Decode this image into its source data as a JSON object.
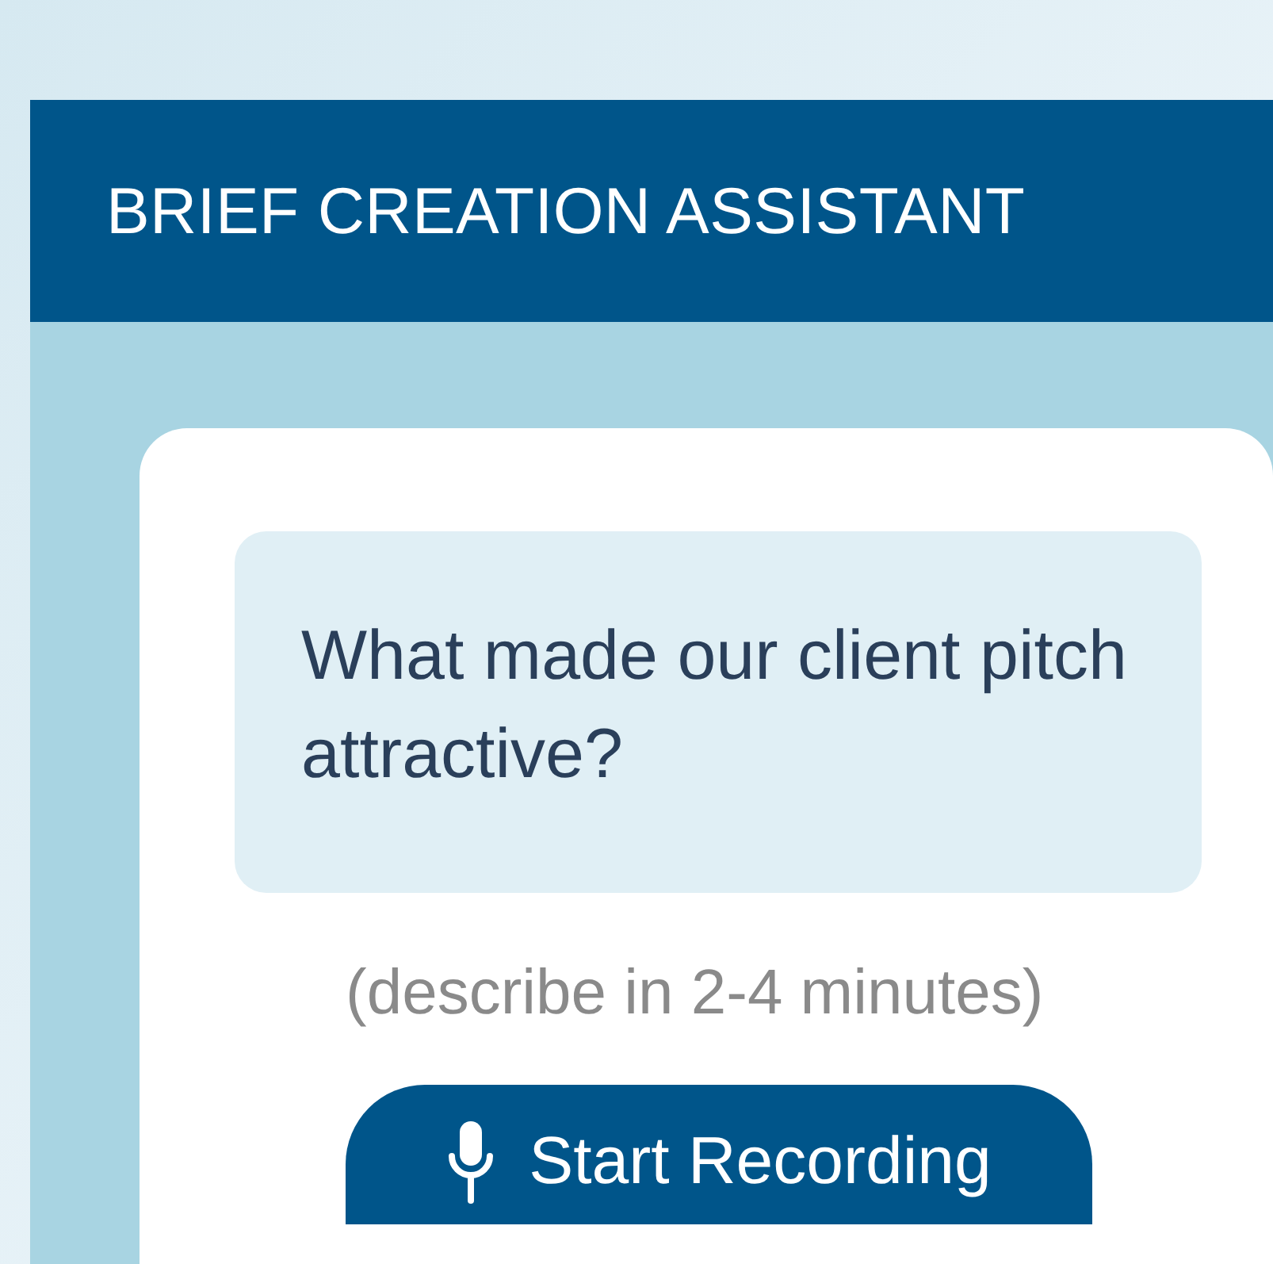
{
  "header": {
    "title": "BRIEF CREATION ASSISTANT"
  },
  "question": {
    "text": "What made our client pitch attractive?"
  },
  "hint": "(describe in 2-4 minutes)",
  "record_button": {
    "label": "Start Recording"
  }
}
